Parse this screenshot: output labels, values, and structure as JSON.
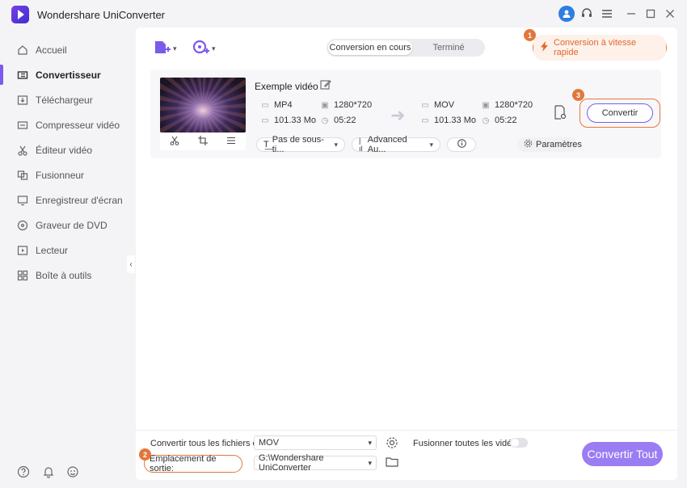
{
  "app": {
    "title": "Wondershare UniConverter"
  },
  "sidebar": {
    "items": [
      {
        "label": "Accueil",
        "icon": "home-icon"
      },
      {
        "label": "Convertisseur",
        "icon": "converter-icon",
        "active": true
      },
      {
        "label": "Téléchargeur",
        "icon": "download-icon"
      },
      {
        "label": "Compresseur vidéo",
        "icon": "compress-icon"
      },
      {
        "label": "Éditeur vidéo",
        "icon": "scissors-icon"
      },
      {
        "label": "Fusionneur",
        "icon": "merge-icon"
      },
      {
        "label": "Enregistreur d'écran",
        "icon": "screen-record-icon"
      },
      {
        "label": "Graveur de DVD",
        "icon": "dvd-icon"
      },
      {
        "label": "Lecteur",
        "icon": "player-icon"
      },
      {
        "label": "Boîte à outils",
        "icon": "toolbox-icon"
      }
    ]
  },
  "tabs": {
    "converting": "Conversion en cours",
    "finished": "Terminé"
  },
  "turbo": {
    "label": "Conversion à vitesse rapide"
  },
  "badges": {
    "b1": "1",
    "b2": "2",
    "b3": "3"
  },
  "file": {
    "name": "Exemple vidéo",
    "source": {
      "format": "MP4",
      "resolution": "1280*720",
      "size": "101.33 Mo",
      "duration": "05:22"
    },
    "target": {
      "format": "MOV",
      "resolution": "1280*720",
      "size": "101.33 Mo",
      "duration": "05:22"
    },
    "subtitle": "Pas de sous-ti...",
    "audio": "Advanced Au...",
    "settings_label": "Paramètres",
    "convert_label": "Convertir"
  },
  "footer": {
    "convert_all_label": "Convertir tous les fichiers en:",
    "convert_all_value": "MOV",
    "merge_label": "Fusionner toutes les vidéos",
    "output_label": "Emplacement de sortie:",
    "output_value": "G:\\Wondershare UniConverter",
    "convert_all_button": "Convertir Tout"
  },
  "colors": {
    "accent": "#7a5bea",
    "highlight": "#e2773b"
  }
}
